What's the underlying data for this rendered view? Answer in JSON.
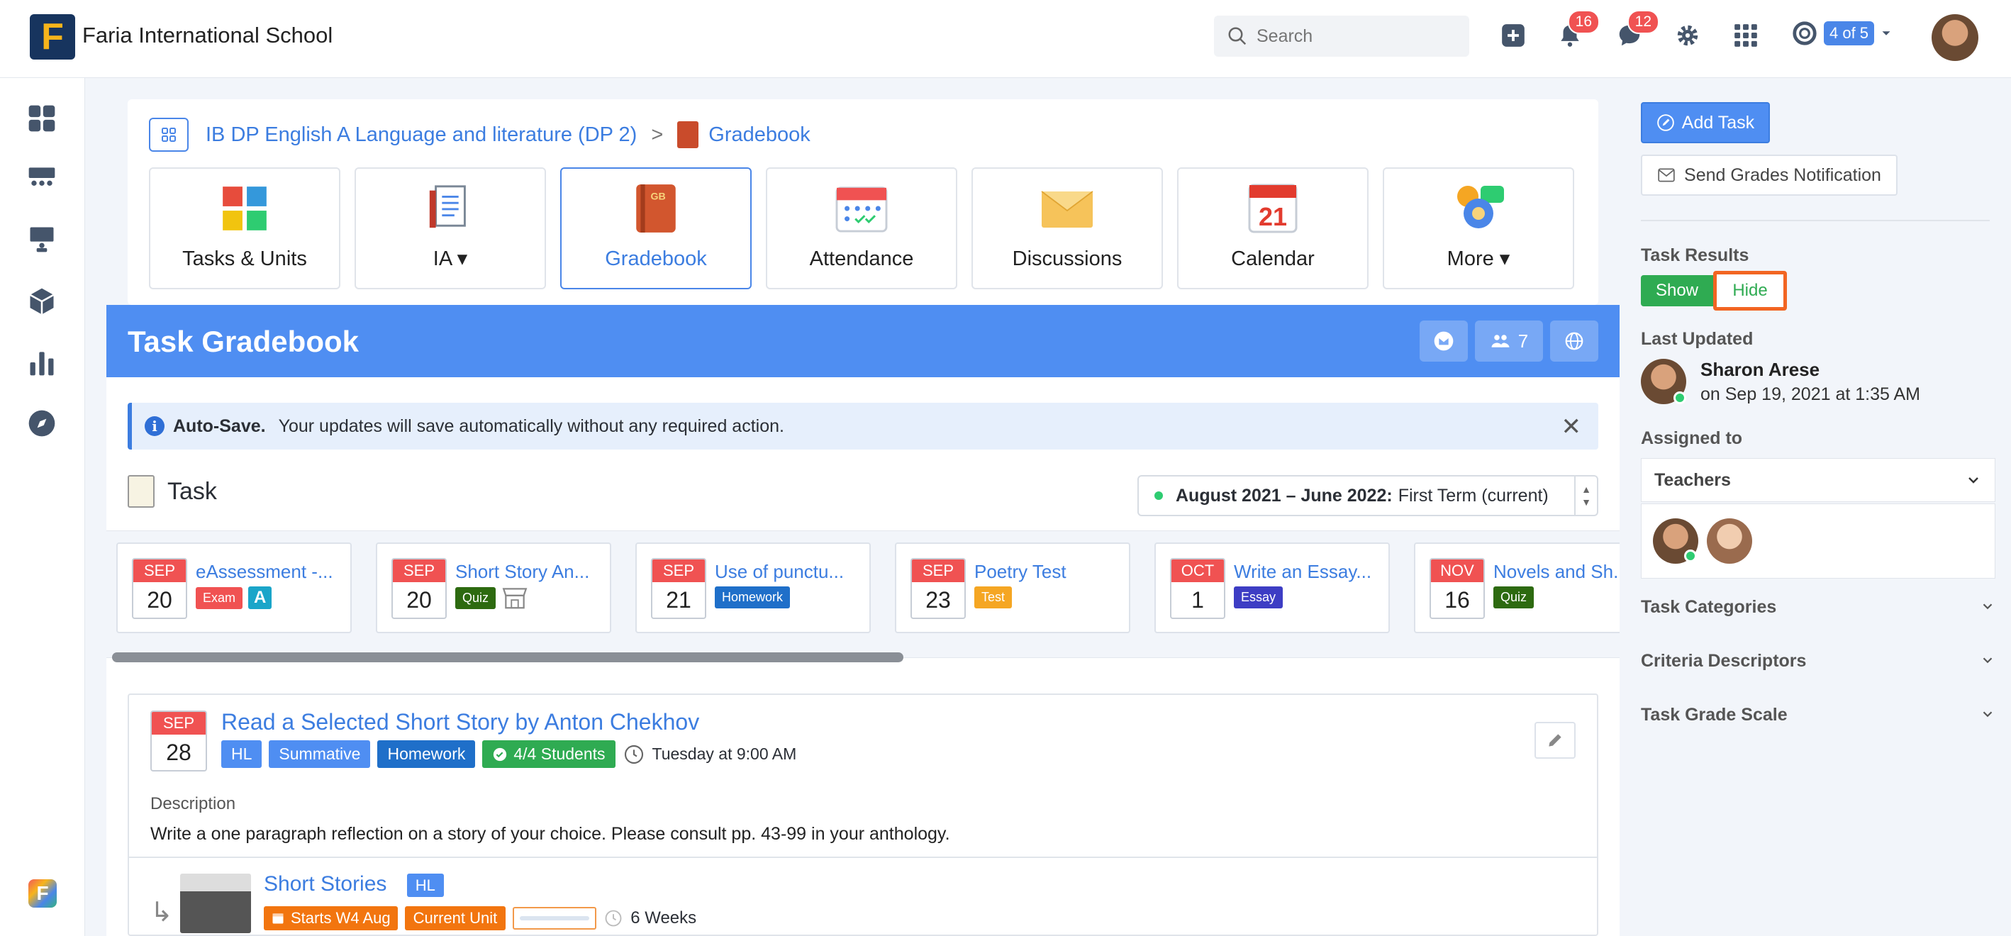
{
  "topbar": {
    "logo_letter": "F",
    "school_name": "Faria International School",
    "search_placeholder": "Search",
    "notifications_count": "16",
    "messages_count": "12",
    "counter_label": "4 of 5"
  },
  "breadcrumb": {
    "course": "IB DP English A Language and literature (DP 2)",
    "separator": ">",
    "current": "Gradebook"
  },
  "nav_tiles": [
    {
      "label": "Tasks & Units"
    },
    {
      "label": "IA ▾"
    },
    {
      "label": "Gradebook"
    },
    {
      "label": "Attendance"
    },
    {
      "label": "Discussions"
    },
    {
      "label": "Calendar",
      "day": "21",
      "month": "Calendar"
    },
    {
      "label": "More ▾"
    }
  ],
  "gradebook": {
    "title": "Task Gradebook",
    "students_count": "7",
    "alert_bold": "Auto-Save.",
    "alert_text": "Your updates will save automatically without any required action.",
    "alert_close": "✕",
    "task_heading": "Task",
    "term_bold": "August 2021 – June 2022:",
    "term_rest": "First Term (current)"
  },
  "tasks": [
    {
      "month": "SEP",
      "day": "20",
      "name": "eAssessment -...",
      "tags": [
        {
          "label": "Exam",
          "color": "#f05252"
        },
        {
          "label": "A",
          "color": "#1aa5c9"
        }
      ]
    },
    {
      "month": "SEP",
      "day": "20",
      "name": "Short Story An...",
      "tags": [
        {
          "label": "Quiz",
          "color": "#2d6a10"
        }
      ]
    },
    {
      "month": "SEP",
      "day": "21",
      "name": "Use of punctu...",
      "tags": [
        {
          "label": "Homework",
          "color": "#1f6fc9"
        }
      ]
    },
    {
      "month": "SEP",
      "day": "23",
      "name": "Poetry Test",
      "tags": [
        {
          "label": "Test",
          "color": "#f5a623"
        }
      ]
    },
    {
      "month": "OCT",
      "day": "1",
      "name": "Write an Essay...",
      "tags": [
        {
          "label": "Essay",
          "color": "#3d3dc4"
        }
      ]
    },
    {
      "month": "NOV",
      "day": "16",
      "name": "Novels and Sh...",
      "tags": [
        {
          "label": "Quiz",
          "color": "#2d6a10"
        }
      ]
    }
  ],
  "detail": {
    "month": "SEP",
    "day": "28",
    "title": "Read a Selected Short Story by Anton Chekhov",
    "pills": [
      "HL",
      "Summative",
      "Homework"
    ],
    "students": "4/4 Students",
    "due": "Tuesday at 9:00 AM",
    "desc_label": "Description",
    "desc_text": "Write a one paragraph reflection on a story of your choice. Please consult pp. 43-99 in your anthology.",
    "unit_name": "Short Stories",
    "unit_level": "HL",
    "unit_starts": "Starts W4 Aug",
    "unit_status": "Current Unit",
    "unit_duration": "6 Weeks"
  },
  "right_panel": {
    "add_task": "Add Task",
    "send_grades": "Send Grades Notification",
    "task_results": "Task Results",
    "show": "Show",
    "hide": "Hide",
    "last_updated": "Last Updated",
    "updater_name": "Sharon Arese",
    "updater_time": "on Sep 19, 2021 at 1:35 AM",
    "assigned_to": "Assigned to",
    "teachers": "Teachers",
    "task_categories": "Task Categories",
    "criteria_descriptors": "Criteria Descriptors",
    "task_grade_scale": "Task Grade Scale"
  }
}
